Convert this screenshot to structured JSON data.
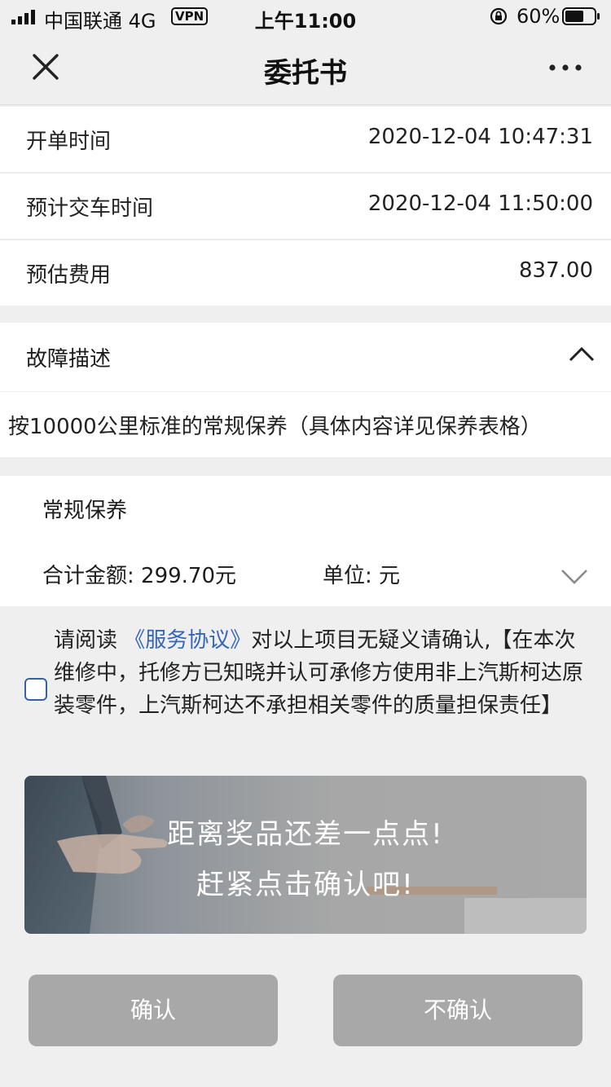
{
  "status_bar": {
    "carrier": "中国联通  4G",
    "vpn": "VPN",
    "time": "上午11:00",
    "battery": "60%"
  },
  "nav": {
    "title": "委托书",
    "close_icon": "close-icon",
    "more_icon": "more-icon"
  },
  "info_rows": [
    {
      "label": "开单时间",
      "value": "2020-12-04 10:47:31"
    },
    {
      "label": "预计交车时间",
      "value": "2020-12-04 11:50:00"
    },
    {
      "label": "预估费用",
      "value": "837.00"
    }
  ],
  "fault": {
    "label": "故障描述",
    "description": "按10000公里标准的常规保养（具体内容详见保养表格）",
    "expanded": true
  },
  "item": {
    "name": "常规保养",
    "total": "合计金额: 299.70元",
    "unit": "单位: 元"
  },
  "agreement": {
    "prefix": "请阅读",
    "link": "《服务协议》",
    "suffix": "对以上项目无疑义请确认,【在本次维修中，托修方已知晓并认可承修方使用非上汽斯柯达原装零件，上汽斯柯达不承担相关零件的质量担保责任】",
    "checked": false,
    "link_color": "#3467b7"
  },
  "banner": {
    "line1": "距离奖品还差一点点!",
    "line2": "赶紧点击确认吧!"
  },
  "buttons": {
    "confirm": "确认",
    "reject": "不确认",
    "disabled_color": "#a8a8a8"
  }
}
